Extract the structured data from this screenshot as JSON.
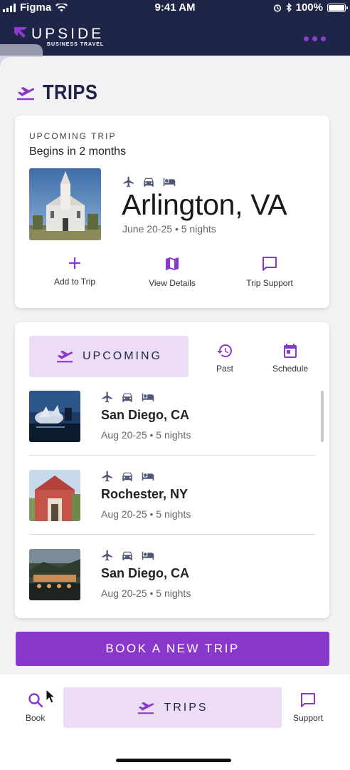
{
  "status_bar": {
    "carrier": "Figma",
    "time": "9:41 AM",
    "battery": "100%"
  },
  "header": {
    "brand": "UPSIDE",
    "brand_sub": "BUSINESS TRAVEL",
    "more_icon": "more-dots-icon"
  },
  "page": {
    "title": "TRIPS",
    "icon": "plane-departure-icon"
  },
  "featured": {
    "eyebrow": "UPCOMING TRIP",
    "begins": "Begins in 2 months",
    "city": "Arlington, VA",
    "dates": "June 20-25 • 5 nights",
    "actions": [
      {
        "label": "Add to Trip",
        "icon": "plus-icon"
      },
      {
        "label": "View Details",
        "icon": "map-icon"
      },
      {
        "label": "Trip Support",
        "icon": "chat-icon"
      }
    ]
  },
  "list": {
    "segment_label": "UPCOMING",
    "past_label": "Past",
    "schedule_label": "Schedule",
    "trips": [
      {
        "city": "San Diego, CA",
        "dates": "Aug 20-25 • 5 nights"
      },
      {
        "city": "Rochester, NY",
        "dates": "Aug 20-25 • 5 nights"
      },
      {
        "city": "San Diego, CA",
        "dates": "Aug 20-25 • 5 nights"
      }
    ]
  },
  "book_button": "BOOK A NEW TRIP",
  "bottom_nav": {
    "book": "Book",
    "trips": "TRIPS",
    "support": "Support"
  },
  "colors": {
    "navy": "#1f2547",
    "purple": "#8a38cc",
    "lavender": "#eddcf6",
    "slate": "#505a78"
  }
}
